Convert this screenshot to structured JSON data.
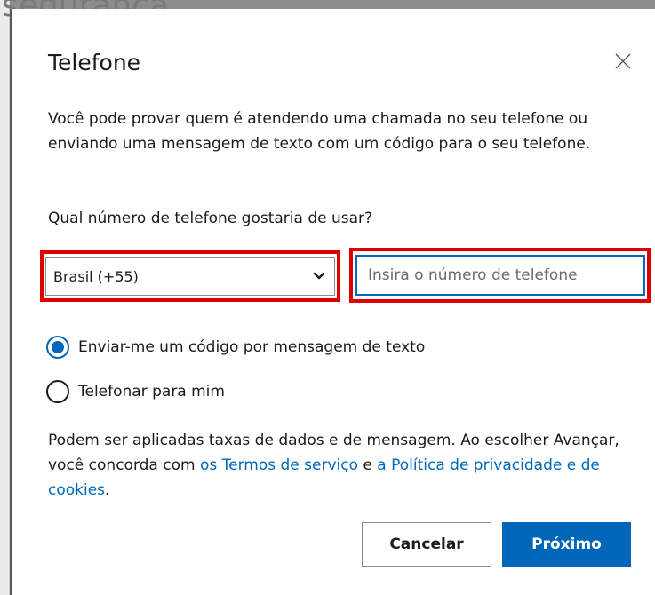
{
  "background": {
    "title_fragment": "segurança"
  },
  "dialog": {
    "title": "Telefone",
    "description": "Você pode provar quem é atendendo uma chamada no seu telefone ou enviando uma mensagem de texto com um código para o seu telefone.",
    "question": "Qual número de telefone gostaria de usar?",
    "country_select": {
      "selected": "Brasil (+55)"
    },
    "phone_input": {
      "value": "",
      "placeholder": "Insira o número de telefone"
    },
    "options": [
      {
        "label": "Enviar-me um código por mensagem de texto",
        "checked": true
      },
      {
        "label": "Telefonar para mim",
        "checked": false
      }
    ],
    "terms": {
      "text_before": "Podem ser aplicadas taxas de dados e de mensagem. Ao escolher Avançar, você concorda com ",
      "link_terms": "os Termos de serviço",
      "text_middle": " e ",
      "link_privacy": "a Política de privacidade e de cookies",
      "text_after": "."
    },
    "buttons": {
      "cancel": "Cancelar",
      "next": "Próximo"
    }
  },
  "colors": {
    "accent": "#0067b8",
    "highlight": "#e00000"
  }
}
